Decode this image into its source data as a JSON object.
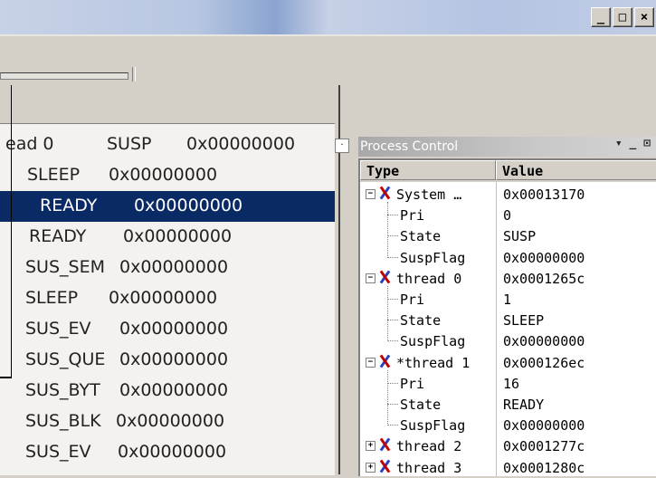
{
  "window": {
    "min_glyph": "_",
    "max_glyph": "□",
    "close_glyph": "×"
  },
  "left_list": {
    "rows": [
      {
        "name": "ead 0",
        "state": "SUSP",
        "value": "0x00000000",
        "selected": false
      },
      {
        "name": "",
        "state": "SLEEP",
        "value": "0x00000000",
        "selected": false
      },
      {
        "name": "",
        "state": "READY",
        "value": "0x00000000",
        "selected": true
      },
      {
        "name": "",
        "state": "READY",
        "value": "0x00000000",
        "selected": false
      },
      {
        "name": "",
        "state": "SUS_SEM",
        "value": "0x00000000",
        "selected": false
      },
      {
        "name": "",
        "state": "SLEEP",
        "value": "0x00000000",
        "selected": false
      },
      {
        "name": "",
        "state": "SUS_EV",
        "value": "0x00000000",
        "selected": false
      },
      {
        "name": "",
        "state": "SUS_QUE",
        "value": "0x00000000",
        "selected": false
      },
      {
        "name": "",
        "state": "SUS_BYT",
        "value": "0x00000000",
        "selected": false
      },
      {
        "name": "",
        "state": "SUS_BLK",
        "value": "0x00000000",
        "selected": false
      },
      {
        "name": "",
        "state": "SUS_EV",
        "value": "0x00000000",
        "selected": false
      }
    ]
  },
  "process_control": {
    "title": "Process Control",
    "controls": "▾ _ ⊡",
    "columns": {
      "type": "Type",
      "value": "Value"
    },
    "rows": [
      {
        "kind": "node",
        "expander": "−",
        "type": "System …",
        "value": "0x00013170"
      },
      {
        "kind": "leaf",
        "type": "Pri",
        "value": "0"
      },
      {
        "kind": "leaf",
        "type": "State",
        "value": "SUSP"
      },
      {
        "kind": "leaf",
        "type": "SuspFlag",
        "value": "0x00000000"
      },
      {
        "kind": "node",
        "expander": "−",
        "type": "thread 0",
        "value": "0x0001265c"
      },
      {
        "kind": "leaf",
        "type": "Pri",
        "value": "1"
      },
      {
        "kind": "leaf",
        "type": "State",
        "value": "SLEEP"
      },
      {
        "kind": "leaf",
        "type": "SuspFlag",
        "value": "0x00000000"
      },
      {
        "kind": "node",
        "expander": "−",
        "type": "*thread 1",
        "value": "0x000126ec"
      },
      {
        "kind": "leaf",
        "type": "Pri",
        "value": "16"
      },
      {
        "kind": "leaf",
        "type": "State",
        "value": "READY"
      },
      {
        "kind": "leaf",
        "type": "SuspFlag",
        "value": "0x00000000"
      },
      {
        "kind": "node",
        "expander": "+",
        "type": "thread 2",
        "value": "0x0001277c"
      },
      {
        "kind": "node",
        "expander": "+",
        "type": "thread 3",
        "value": "0x0001280c"
      }
    ]
  }
}
